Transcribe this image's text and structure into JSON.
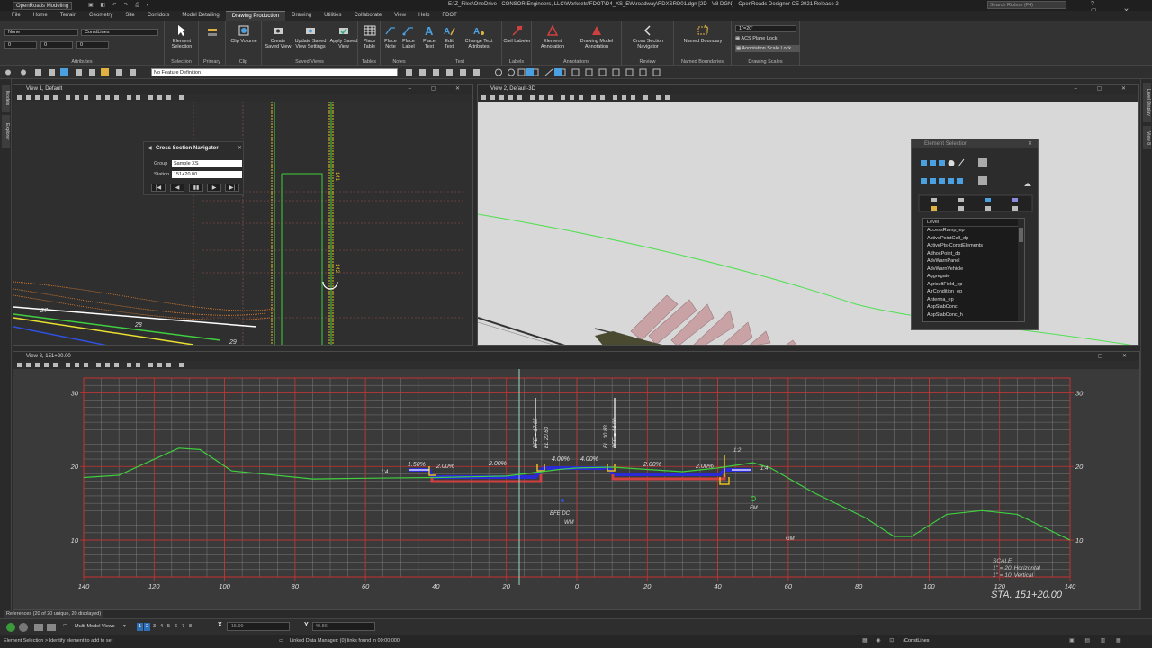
{
  "titlebar": {
    "workspace": "OpenRoads Modeling",
    "title": "E:\\Z_Files\\OneDrive - CONSOR Engineers, LLC\\Worksets\\FDOT\\D4_XS_EW\\roadway\\RDXSRD01.dgn [2D - V8 DGN] - OpenRoads Designer CE 2021 Release 2",
    "search_placeholder": "Search Ribbon (F4)"
  },
  "menu_tabs": [
    "File",
    "Home",
    "Terrain",
    "Geometry",
    "Site",
    "Corridors",
    "Model Detailing",
    "Drawing Production",
    "Drawing",
    "Utilities",
    "Collaborate",
    "View",
    "Help",
    "FDOT"
  ],
  "active_tab": "Drawing Production",
  "ribbon": {
    "attributes": {
      "level": "None",
      "style": "ConstLines",
      "weight": "0",
      "line": "0",
      "color": "0",
      "label": "Attributes"
    },
    "selection": {
      "button": "Element Selection",
      "label": "Selection"
    },
    "primary": {
      "label": "Primary"
    },
    "clip": {
      "button": "Clip Volume",
      "label": "Clip"
    },
    "saved_views": {
      "buttons": [
        "Create Saved View",
        "Update Saved View Settings",
        "Apply Saved View"
      ],
      "label": "Saved Views"
    },
    "tables": {
      "button": "Place Table",
      "label": "Tables"
    },
    "notes": {
      "buttons": [
        "Place Note",
        "Place Label"
      ],
      "label": "Notes"
    },
    "text": {
      "buttons": [
        "Place Text",
        "Edit Text",
        "Change Text Attributes"
      ],
      "label": "Text"
    },
    "labels": {
      "button": "Civil Labeler",
      "label": "Labels"
    },
    "annotations": {
      "buttons": [
        "Element Annotation",
        "Drawing Model Annotation"
      ],
      "label": "Annotations"
    },
    "review": {
      "button": "Cross Section Navigator",
      "label": "Review"
    },
    "named_boundaries": {
      "button": "Named Boundary",
      "label": "Named Boundaries"
    },
    "drawing_scales": {
      "scale": "1\"=20'",
      "acs_lock": "ACS Plane Lock",
      "anno_lock": "Annotation Scale Lock",
      "label": "Drawing Scales"
    }
  },
  "feature_definition": "No Feature Definition",
  "left_dock": [
    "Models",
    "Explorer"
  ],
  "right_dock": [
    "Level Display",
    "View 8"
  ],
  "view1": {
    "title": "View 1, Default",
    "labels": [
      "27",
      "28",
      "29",
      "141",
      "142"
    ],
    "navigator": {
      "title": "Cross Section Navigator",
      "group_label": "Group",
      "group_value": "Sample XS",
      "station_label": "Station",
      "station_value": "151+20.00",
      "buttons": [
        "|◀",
        "◀",
        "▮▮",
        "▶",
        "▶|"
      ]
    }
  },
  "view2": {
    "title": "View 2, Default-3D"
  },
  "element_selection": {
    "title": "Element Selection",
    "list_header": "Level",
    "levels": [
      "AccessRamp_ep",
      "ActivePointCell_dp",
      "ActivePts-ConstElements",
      "AdhocPoint_dp",
      "AdvWarnPanel",
      "AdvWarnVehicle",
      "Aggregate",
      "AgricultField_ep",
      "AirCondition_ep",
      "Antenna_ep",
      "AppSlabConc",
      "AppSlabConc_h"
    ]
  },
  "view8": {
    "title": "View 8, 151+20.00",
    "station": "STA. 151+20.00",
    "scale": [
      "SCALE",
      "1\" = 20' Horizontal",
      "1\" = 10' Vertical"
    ],
    "labels": {
      "slopes": [
        "1.50%",
        "2.00%",
        "2.00%",
        "4.00%",
        "4.00%",
        "2.00%",
        "2.00%"
      ],
      "side_slopes": [
        "1:4",
        "1:4",
        "1:2"
      ],
      "elevs": [
        "BFE = 17.65",
        "EL 20.63",
        "EL. 30.83",
        "BFE = 14.00"
      ],
      "utility": [
        "BFE DC",
        "WM",
        "FM",
        "GM"
      ]
    },
    "chart_data": {
      "type": "line",
      "title": "",
      "xlabel": "",
      "ylabel": "",
      "xlim": [
        -140,
        140
      ],
      "ylim": [
        5,
        32
      ],
      "x_ticks": [
        140,
        120,
        100,
        80,
        60,
        40,
        20,
        0,
        20,
        40,
        60,
        80,
        100,
        120,
        140
      ],
      "y_ticks": [
        10,
        20,
        30
      ],
      "series": [
        {
          "x": [
            -140,
            -130,
            -113,
            -107,
            -98,
            -75,
            -60,
            -40,
            -30,
            -20,
            -10,
            -5,
            0,
            10,
            20,
            30,
            40,
            50,
            55,
            67,
            82,
            90,
            95,
            105,
            115,
            125,
            140
          ],
          "y": [
            18.5,
            18.8,
            22.5,
            22.3,
            19.4,
            18.3,
            18.4,
            18.5,
            18.6,
            18.7,
            19.3,
            19.6,
            19.8,
            19.9,
            19.6,
            19.3,
            19.8,
            20.5,
            19.8,
            16.5,
            13.0,
            10.5,
            10.5,
            13.5,
            14.0,
            13.5,
            10.0
          ]
        }
      ]
    }
  },
  "reference_bar": "References (20 of 20 unique, 20 displayed)",
  "coords": {
    "x_label": "X",
    "x_value": "-15.99",
    "y_label": "Y",
    "y_value": "40.86"
  },
  "view_buttons": [
    "1",
    "2",
    "3",
    "4",
    "5",
    "6",
    "7",
    "8"
  ],
  "multi_model": "Multi-Model Views",
  "status": {
    "prompt": "Element Selection > Identify element to add to set",
    "linked": "Linked Data Manager: (0) links found in 00:00:000",
    "level": "ConstLines"
  },
  "colors": {
    "grid_major": "#c83232",
    "grid_minor": "#8a8a8a",
    "ground": "#3fcf3f",
    "pavement": "#2a2ad8",
    "base": "#d04040",
    "curb": "#e8c020"
  }
}
